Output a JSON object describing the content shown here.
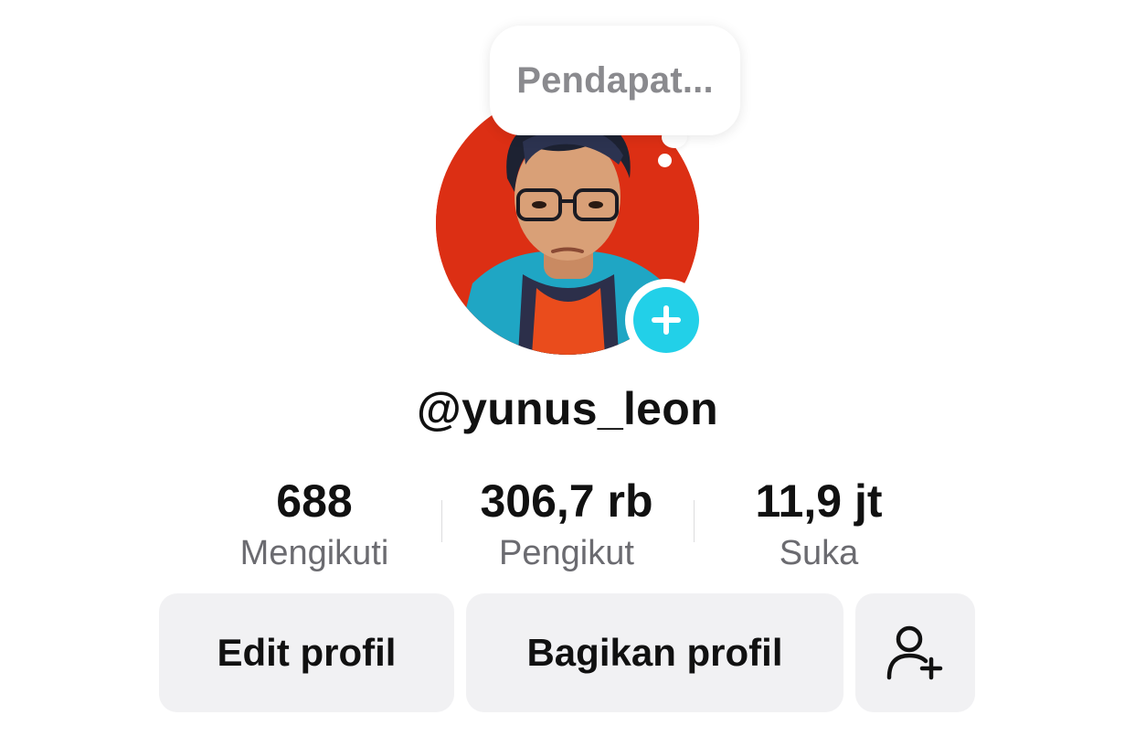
{
  "note": {
    "placeholder_text": "Pendapat..."
  },
  "profile": {
    "username": "@yunus_leon",
    "avatar_icon": "avatar-photo",
    "add_icon": "plus-icon"
  },
  "stats": [
    {
      "value": "688",
      "label": "Mengikuti"
    },
    {
      "value": "306,7 rb",
      "label": "Pengikut"
    },
    {
      "value": "11,9 jt",
      "label": "Suka"
    }
  ],
  "actions": {
    "edit_label": "Edit profil",
    "share_label": "Bagikan profil",
    "add_friend_icon": "add-user-icon"
  },
  "colors": {
    "accent": "#22d0e8",
    "avatar_bg": "#dc2f14",
    "button_bg": "#f1f1f3",
    "muted_text": "#6b6b70"
  }
}
